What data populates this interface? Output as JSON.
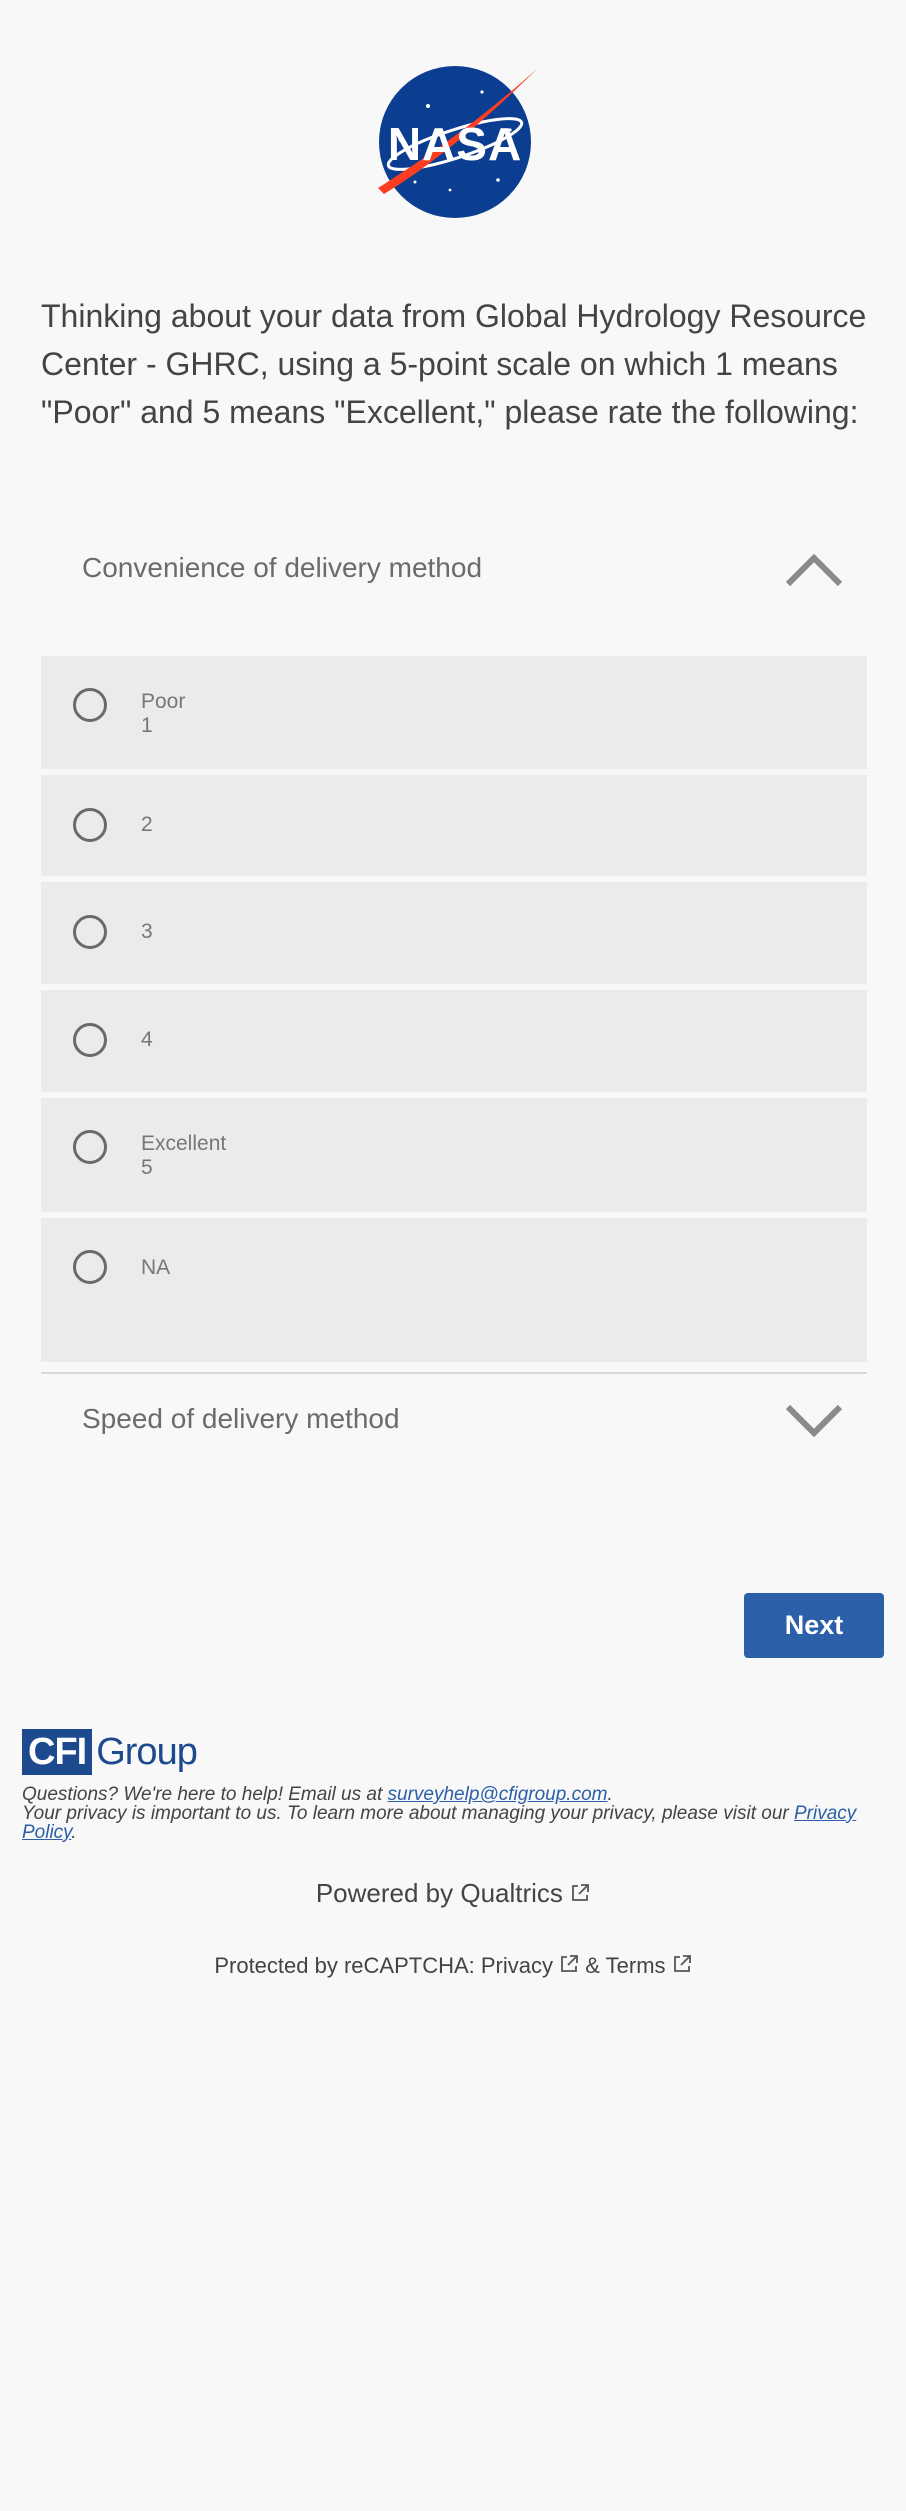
{
  "logo": {
    "text": "NASA",
    "colors": {
      "blue": "#0b3d91",
      "red": "#fc3d21"
    }
  },
  "question": {
    "text": "Thinking about your data from Global Hydrology Resource Center - GHRC, using a 5-point scale on which 1 means \"Poor\" and 5 means \"Excellent,\" please rate the following:"
  },
  "items": [
    {
      "label": "Convenience of delivery method",
      "expanded": true,
      "chevron": "chevron-up-icon",
      "options": [
        {
          "line1": "Poor",
          "line2": "1"
        },
        {
          "line1": "2",
          "line2": ""
        },
        {
          "line1": "3",
          "line2": ""
        },
        {
          "line1": "4",
          "line2": ""
        },
        {
          "line1": "Excellent",
          "line2": "5"
        },
        {
          "line1": "NA",
          "line2": ""
        }
      ]
    },
    {
      "label": "Speed of delivery method",
      "expanded": false,
      "chevron": "chevron-down-icon"
    }
  ],
  "next_button": {
    "label": "Next",
    "color": "#2b5fa8"
  },
  "footer": {
    "brand_box": "CFI",
    "brand_word": "Group",
    "questions_text": "Questions? We're here to help! Email us at ",
    "email": "surveyhelp@cfigroup.com",
    "after_email": ".",
    "privacy_text": "Your privacy is important to us. To learn more about managing your privacy, please visit our ",
    "privacy_link": "Privacy Policy",
    "after_privacy": ".",
    "powered_by": "Powered by Qualtrics",
    "recaptcha_prefix": "Protected by reCAPTCHA: ",
    "privacy": "Privacy",
    "amp": " & ",
    "terms": "Terms"
  }
}
